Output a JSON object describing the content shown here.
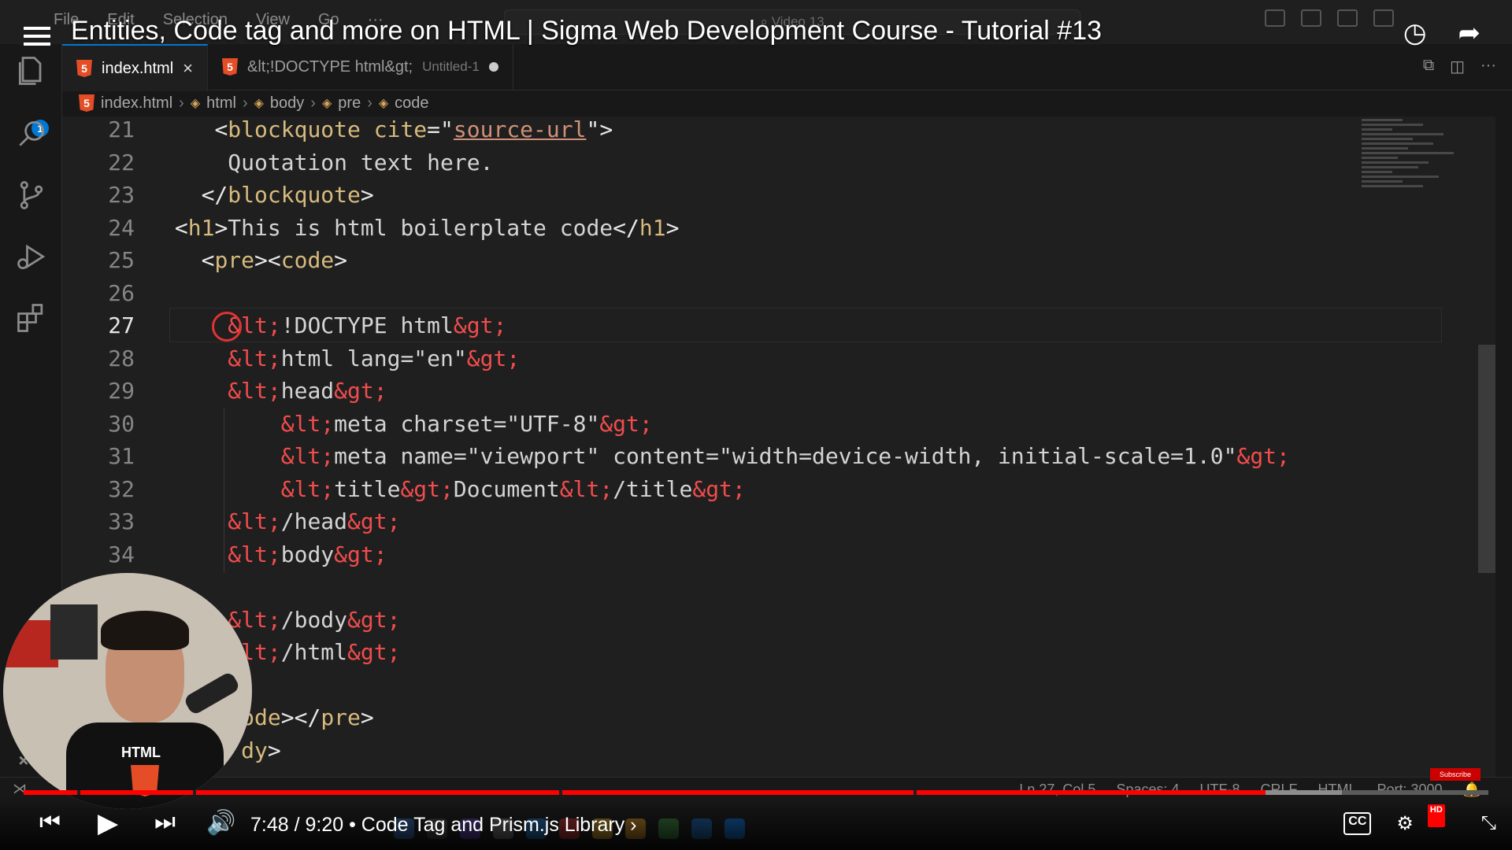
{
  "video": {
    "title": "Entities, Code tag and more on HTML | Sigma Web Development Course - Tutorial #13",
    "time": "7:48 / 9:20",
    "chapter": "• Code Tag and Prism.js Library ›",
    "progress_fraction": 0.848,
    "buffer_fraction": 0.9
  },
  "vscode": {
    "menu": [
      "File",
      "Edit",
      "Selection",
      "View",
      "Go",
      "···"
    ],
    "command_center": "Video 13",
    "explorer_badge": "1",
    "tabs": [
      {
        "label": "index.html",
        "close": "×"
      },
      {
        "label": "&lt;!DOCTYPE html&gt;",
        "sub": "Untitled-1"
      }
    ],
    "tab_actions": "···",
    "breadcrumb": [
      "index.html",
      "html",
      "body",
      "pre",
      "code"
    ],
    "status": {
      "position": "Ln 27, Col 5",
      "spaces": "Spaces: 4",
      "encoding": "UTF-8",
      "eol": "CRLF",
      "language": "HTML",
      "port": "Port: 3000"
    }
  },
  "code_lines": [
    {
      "n": "21",
      "segs": [
        [
          "t",
          "    "
        ],
        [
          "tag",
          "<"
        ],
        [
          "name",
          "blockquote"
        ],
        [
          "t",
          " "
        ],
        [
          "attr",
          "cite"
        ],
        [
          "tag",
          "=\""
        ],
        [
          "str",
          "source-url"
        ],
        [
          "tag",
          "\">"
        ]
      ]
    },
    {
      "n": "22",
      "segs": [
        [
          "t",
          "     Quotation text here."
        ]
      ]
    },
    {
      "n": "23",
      "segs": [
        [
          "t",
          "   "
        ],
        [
          "tag",
          "</"
        ],
        [
          "name",
          "blockquote"
        ],
        [
          "tag",
          ">"
        ]
      ]
    },
    {
      "n": "24",
      "segs": [
        [
          "t",
          " "
        ],
        [
          "tag",
          "<"
        ],
        [
          "name",
          "h1"
        ],
        [
          "tag",
          ">"
        ],
        [
          "t",
          "This is html boilerplate code"
        ],
        [
          "tag",
          "</"
        ],
        [
          "name",
          "h1"
        ],
        [
          "tag",
          ">"
        ]
      ]
    },
    {
      "n": "25",
      "segs": [
        [
          "t",
          "   "
        ],
        [
          "tag",
          "<"
        ],
        [
          "name",
          "pre"
        ],
        [
          "tag",
          "><"
        ],
        [
          "name",
          "code"
        ],
        [
          "tag",
          ">"
        ]
      ]
    },
    {
      "n": "26",
      "segs": [
        [
          "t",
          ""
        ]
      ]
    },
    {
      "n": "27",
      "segs": [
        [
          "t",
          "     "
        ],
        [
          "ent",
          "&lt;"
        ],
        [
          "t",
          "!DOCTYPE html"
        ],
        [
          "ent",
          "&gt;"
        ]
      ]
    },
    {
      "n": "28",
      "segs": [
        [
          "t",
          "     "
        ],
        [
          "ent",
          "&lt;"
        ],
        [
          "t",
          "html lang=\"en\""
        ],
        [
          "ent",
          "&gt;"
        ]
      ]
    },
    {
      "n": "29",
      "segs": [
        [
          "t",
          "     "
        ],
        [
          "ent",
          "&lt;"
        ],
        [
          "t",
          "head"
        ],
        [
          "ent",
          "&gt;"
        ]
      ]
    },
    {
      "n": "30",
      "segs": [
        [
          "t",
          "         "
        ],
        [
          "ent",
          "&lt;"
        ],
        [
          "t",
          "meta charset=\"UTF-8\""
        ],
        [
          "ent",
          "&gt;"
        ]
      ]
    },
    {
      "n": "31",
      "segs": [
        [
          "t",
          "         "
        ],
        [
          "ent",
          "&lt;"
        ],
        [
          "t",
          "meta name=\"viewport\" content=\"width=device-width, initial-scale=1.0\""
        ],
        [
          "ent",
          "&gt;"
        ]
      ]
    },
    {
      "n": "32",
      "segs": [
        [
          "t",
          "         "
        ],
        [
          "ent",
          "&lt;"
        ],
        [
          "t",
          "title"
        ],
        [
          "ent",
          "&gt;"
        ],
        [
          "t",
          "Document"
        ],
        [
          "ent",
          "&lt;"
        ],
        [
          "t",
          "/title"
        ],
        [
          "ent",
          "&gt;"
        ]
      ]
    },
    {
      "n": "33",
      "segs": [
        [
          "t",
          "     "
        ],
        [
          "ent",
          "&lt;"
        ],
        [
          "t",
          "/head"
        ],
        [
          "ent",
          "&gt;"
        ]
      ]
    },
    {
      "n": "34",
      "segs": [
        [
          "t",
          "     "
        ],
        [
          "ent",
          "&lt;"
        ],
        [
          "t",
          "body"
        ],
        [
          "ent",
          "&gt;"
        ]
      ]
    },
    {
      "n": "",
      "segs": [
        [
          "t",
          ""
        ]
      ]
    },
    {
      "n": "",
      "segs": [
        [
          "t",
          "     "
        ],
        [
          "ent",
          "&lt;"
        ],
        [
          "t",
          "/body"
        ],
        [
          "ent",
          "&gt;"
        ]
      ]
    },
    {
      "n": "",
      "segs": [
        [
          "t",
          "      "
        ],
        [
          "ent",
          "lt;"
        ],
        [
          "t",
          "/html"
        ],
        [
          "ent",
          "&gt;"
        ]
      ]
    },
    {
      "n": "",
      "segs": [
        [
          "t",
          ""
        ]
      ]
    },
    {
      "n": "",
      "segs": [
        [
          "t",
          "      "
        ],
        [
          "name",
          "ode"
        ],
        [
          "tag",
          "></"
        ],
        [
          "name",
          "pre"
        ],
        [
          "tag",
          ">"
        ]
      ]
    },
    {
      "n": "",
      "segs": [
        [
          "t",
          "      "
        ],
        [
          "name",
          "dy"
        ],
        [
          "tag",
          ">"
        ]
      ]
    }
  ],
  "webcam": {
    "shirt_text": "HTML"
  },
  "subscribe": "Subscribe",
  "colors": {
    "red": "#ff0000",
    "entity": "#f14c4c",
    "tag_name": "#d7ba7d",
    "string": "#ce9178"
  }
}
